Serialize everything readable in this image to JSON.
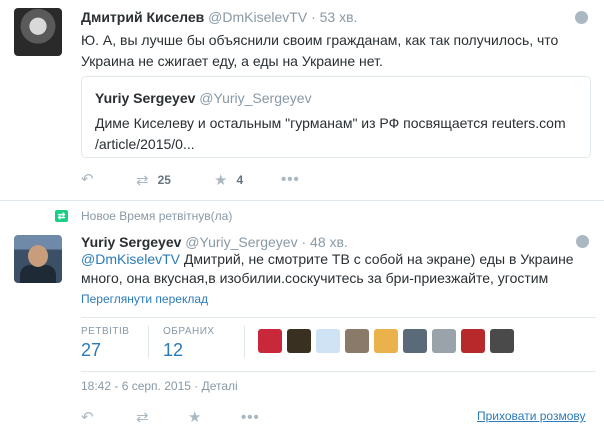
{
  "tweet1": {
    "author_name": "Дмитрий Киселев",
    "author_handle": "@DmKiselevTV",
    "dot": "·",
    "time": "53 хв.",
    "text": "Ю. А, вы лучше бы объяснили своим гражданам, как так получилось, что Украина не сжигает еду, а еды на Украине нет.",
    "quote": {
      "author_name": "Yuriy Sergeyev",
      "author_handle": "@Yuriy_Sergeyev",
      "text": "Диме Киселеву и остальным \"гурманам\" из РФ посвящается reuters.com /article/2015/0..."
    },
    "actions": {
      "reply_icon": "reply-icon",
      "retweet_icon": "retweet-icon",
      "retweet_count": "25",
      "favorite_icon": "star-icon",
      "favorite_count": "4",
      "more_icon": "more-icon"
    }
  },
  "tweet2": {
    "retweet_context": "Новое Время ретвітнув(ла)",
    "author_name": "Yuriy Sergeyev",
    "author_handle": "@Yuriy_Sergeyev",
    "dot": "·",
    "time": "48 хв.",
    "mention": "@DmKiselevTV",
    "text": " Дмитрий, не смотрите ТВ с собой на экране) еды в Украине много, она вкусная,в изобилии.соскучитесь за бри-приезжайте, угостим",
    "translate_link": "Переглянути переклад",
    "stats": {
      "retweets_label": "РЕТВІТІВ",
      "retweets_value": "27",
      "favorites_label": "ОБРАНИХ",
      "favorites_value": "12"
    },
    "datetime": "18:42 - 6 серп. 2015 · Деталі",
    "hide_conversation": "Приховати розмову"
  },
  "colors": {
    "link": "#2b7bb9",
    "muted": "#8899a6",
    "icon": "#aab8c2",
    "retweet_green": "#19cf86",
    "border": "#e1e8ed"
  }
}
